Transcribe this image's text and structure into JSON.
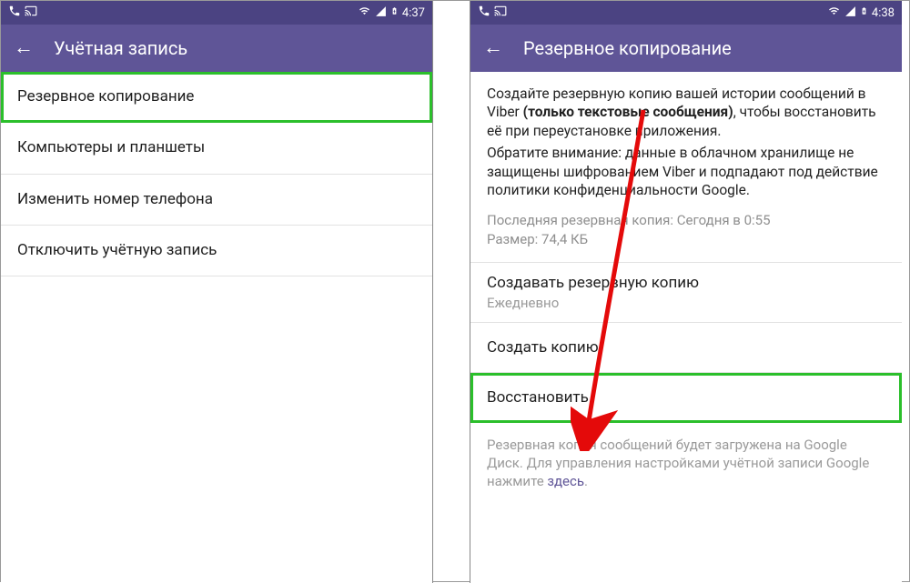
{
  "left": {
    "status": {
      "time": "4:37"
    },
    "appbar": {
      "title": "Учётная запись"
    },
    "items": [
      "Резервное копирование",
      "Компьютеры и планшеты",
      "Изменить номер телефона",
      "Отключить учётную запись"
    ]
  },
  "right": {
    "status": {
      "time": "4:38"
    },
    "appbar": {
      "title": "Резервное копирование"
    },
    "desc": {
      "part1": "Создайте резервную копию вашей истории сообщений в Viber ",
      "bold": "(только текстовые сообщения)",
      "part2": ", чтобы восстановить её при переустановке приложения.",
      "note": "Обратите внимание: данные в облачном хранилище не защищены шифрованием Viber и подпадают под действие политики конфиденциальности Google."
    },
    "meta": {
      "last_backup": "Последняя резервная копия: Сегодня в 0:55",
      "size": "Размер: 74,4 КБ"
    },
    "schedule": {
      "title": "Создавать резервную копию",
      "value": "Ежедневно"
    },
    "create": "Создать копию",
    "restore": "Восстановить",
    "footer": {
      "text": "Резервная копия сообщений будет загружена на Google Диск. Для управления настройками учётной записи Google нажмите ",
      "link": "здесь",
      "end": "."
    }
  }
}
